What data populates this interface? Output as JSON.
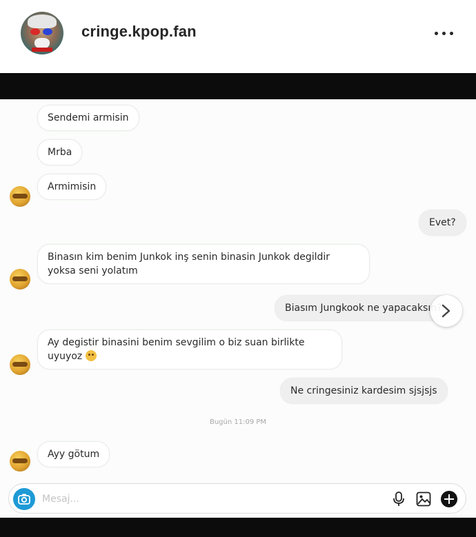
{
  "post": {
    "username": "cringe.kpop.fan"
  },
  "chat": {
    "messages": [
      {
        "text": "Sendemi armisin",
        "side": "left"
      },
      {
        "text": "Mrba",
        "side": "left"
      },
      {
        "text": "Armimisin",
        "side": "left"
      },
      {
        "text": "Evet?",
        "side": "right"
      },
      {
        "text": "Binasın kim benim Junkok inş senin binasin Junkok degildir yoksa seni yolatım",
        "side": "left"
      },
      {
        "text": "Biasım Jungkook ne yapacaksın?",
        "side": "right"
      },
      {
        "text": "Ay degistir binasini benim sevgilim o biz suan birlikte uyuyoz",
        "side": "left"
      },
      {
        "text": "Ne cringesiniz kardesim sjsjsjs",
        "side": "right"
      },
      {
        "text": "Ayy götum",
        "side": "left"
      }
    ],
    "timestamp": "Bugün 11:09 PM",
    "composer_placeholder": "Mesaj..."
  },
  "icons": {
    "more": "more-options-icon",
    "next": "chevron-right-icon",
    "camera": "camera-icon",
    "mic": "microphone-icon",
    "gallery": "gallery-icon",
    "plus": "plus-icon"
  },
  "colors": {
    "username": "#262626",
    "camera_button": "#1e9ad6",
    "outgoing_bubble": "#efefef",
    "incoming_bubble": "#ffffff"
  }
}
